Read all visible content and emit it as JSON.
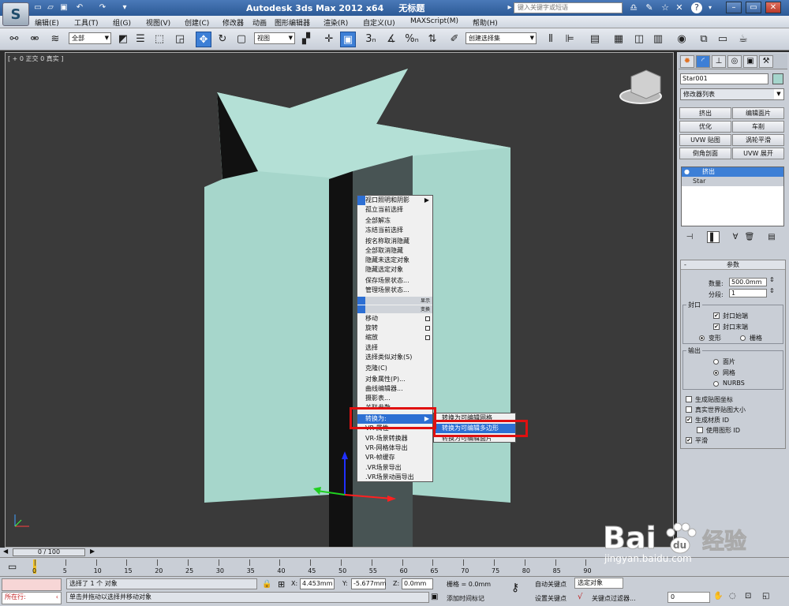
{
  "app": {
    "title": "Autodesk 3ds Max  2012 x64",
    "doc_name": "无标题",
    "search_placeholder": "键入关键字或短语",
    "logo_glyph": "S"
  },
  "menu": [
    "编辑(E)",
    "工具(T)",
    "组(G)",
    "视图(V)",
    "创建(C)",
    "修改器",
    "动画",
    "图形编辑器",
    "渲染(R)",
    "自定义(U)",
    "MAXScript(M)",
    "帮助(H)"
  ],
  "toolbar": {
    "select_filter": "全部",
    "ref_coord": "视图",
    "named_sel": "创建选择集",
    "snap_3": "3",
    "percent": "%"
  },
  "viewport": {
    "label": "[ + 0 正交 0 真实 ]"
  },
  "context_menu": {
    "items": [
      {
        "label": "视口照明和阴影",
        "arrow": true
      },
      {
        "label": "孤立当前选择"
      },
      {
        "label": "全部解冻"
      },
      {
        "label": "冻结当前选择"
      },
      {
        "label": "按名称取消隐藏"
      },
      {
        "label": "全部取消隐藏"
      },
      {
        "label": "隐藏未选定对象"
      },
      {
        "label": "隐藏选定对象"
      },
      {
        "label": "保存场景状态..."
      },
      {
        "label": "管理场景状态..."
      }
    ],
    "section_display": "显示",
    "section_transform": "变换",
    "items2": [
      "移动",
      "旋转",
      "缩放",
      "选择",
      "选择类似对象(S)",
      "克隆(C)",
      "对象属性(P)...",
      "曲线编辑器...",
      "摄影表...",
      "关联参数"
    ],
    "convert_to": "转换为:",
    "items3": [
      "VR-属性",
      "VR-场景转换器",
      "VR-网格体导出",
      "VR-帧缓存",
      ".VR场景导出",
      ".VR场景动画导出"
    ],
    "submenu": [
      "转换为可编辑网格",
      "转换为可编辑多边形",
      "转换为可编辑面片"
    ]
  },
  "command_panel": {
    "object_name": "Star001",
    "object_color": "#a5d5cc",
    "modifier_list": "修改器列表",
    "modifier_buttons": [
      "挤出",
      "编辑面片",
      "优化",
      "车削",
      "UVW 贴图",
      "涡轮平滑",
      "倒角剖面",
      "UVW 展开"
    ],
    "stack": [
      "挤出",
      "Star"
    ],
    "params": {
      "title": "参数",
      "amount_label": "数量:",
      "amount_value": "500.0mm",
      "segments_label": "分段:",
      "segments_value": "1",
      "capping_label": "封口",
      "cap_start": "封口始端",
      "cap_end": "封口末端",
      "morph": "变形",
      "grid": "栅格",
      "output_label": "输出",
      "patch": "面片",
      "mesh": "网格",
      "nurbs": "NURBS",
      "gen_map": "生成贴图坐标",
      "real_world": "真实世界贴图大小",
      "gen_mat": "生成材质 ID",
      "use_shape": "使用图形 ID",
      "smooth": "平滑"
    }
  },
  "timeline": {
    "slider": "0 / 100",
    "ticks": [
      "0",
      "5",
      "10",
      "15",
      "20",
      "25",
      "30",
      "35",
      "40",
      "45",
      "50",
      "55",
      "60",
      "65",
      "70",
      "75",
      "80",
      "85",
      "90"
    ]
  },
  "status": {
    "left_label": "所在行:",
    "msg1": "选择了 1 个 对象",
    "msg2": "单击并拖动以选择并移动对象",
    "x_label": "X:",
    "x": "4.453mm",
    "y_label": "Y:",
    "y": "-5.677mm",
    "z_label": "Z:",
    "z": "0.0mm",
    "grid": "栅格 = 0.0mm",
    "auto_key": "自动关键点",
    "selected": "选定对象",
    "set_key": "设置关键点",
    "key_filter": "关键点过滤器...",
    "add_time_tag": "添加时间标记",
    "frame": "0"
  },
  "watermark": {
    "brand": "Bai",
    "brand2": "du",
    "suffix": "经验",
    "url": "jingyan.baidu.com"
  }
}
